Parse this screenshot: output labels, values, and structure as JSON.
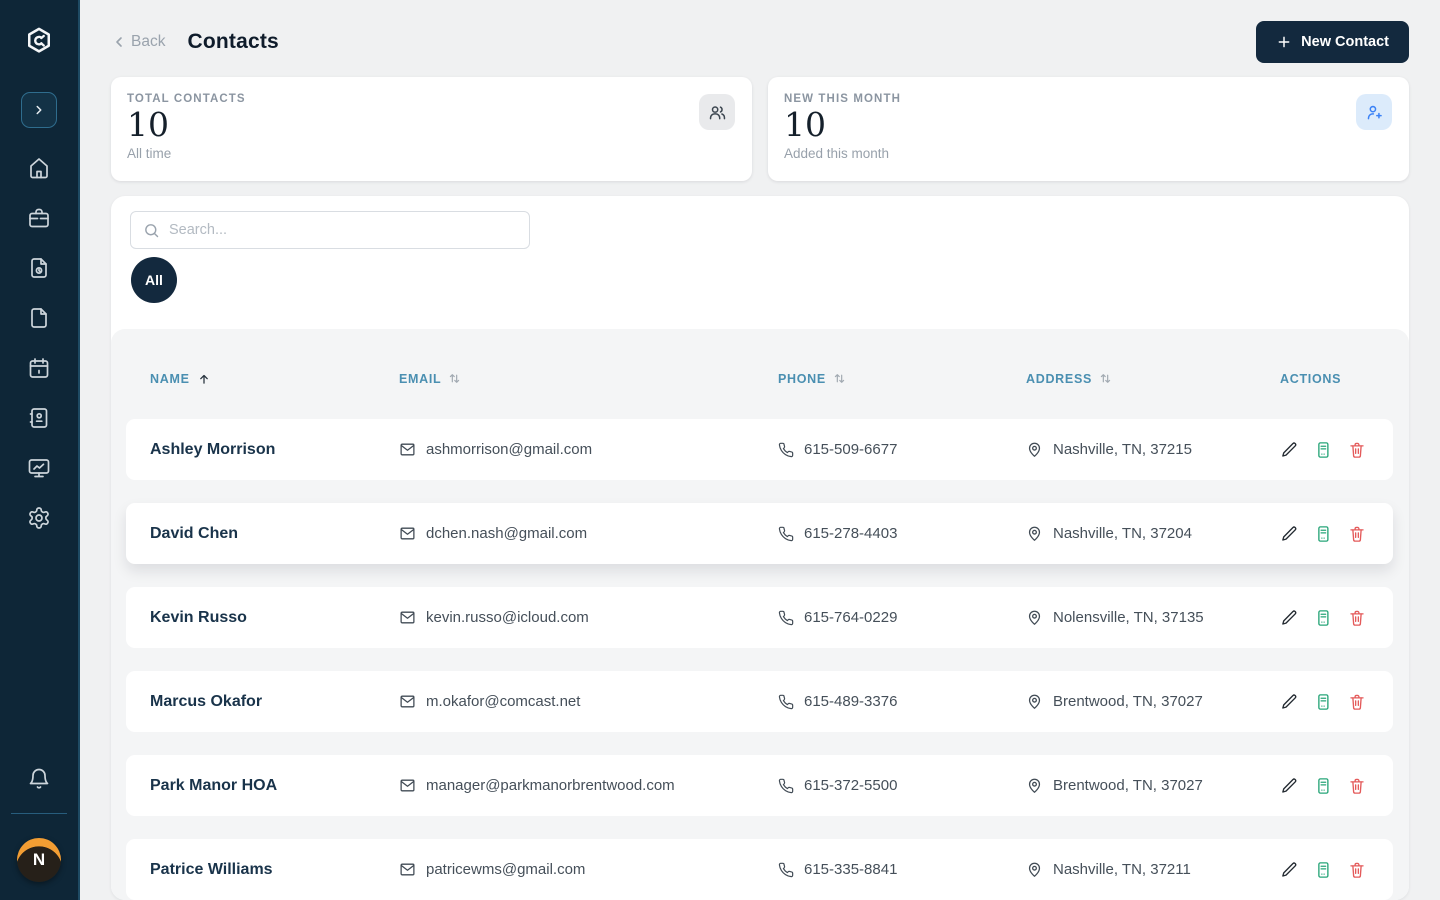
{
  "sidebar": {
    "icons": [
      "logo-hex-wrench-icon",
      "collapse-chevron-icon",
      "home-icon",
      "briefcase-icon",
      "file-badge-icon",
      "file-icon",
      "calendar-icon",
      "contact-book-icon",
      "monitor-chart-icon",
      "gear-icon",
      "bell-icon"
    ],
    "avatar_initial": "N"
  },
  "header": {
    "back_label": "Back",
    "title": "Contacts",
    "new_contact_label": "New Contact"
  },
  "stats": [
    {
      "label": "TOTAL CONTACTS",
      "value": "10",
      "sublabel": "All time",
      "icon": "users-icon"
    },
    {
      "label": "NEW THIS MONTH",
      "value": "10",
      "sublabel": "Added this month",
      "icon": "user-plus-icon"
    }
  ],
  "filters": {
    "search_placeholder": "Search...",
    "filter_all_label": "All"
  },
  "table": {
    "columns": [
      {
        "label": "NAME",
        "sort": "asc"
      },
      {
        "label": "EMAIL",
        "sort": "both"
      },
      {
        "label": "PHONE",
        "sort": "both"
      },
      {
        "label": "ADDRESS",
        "sort": "both"
      },
      {
        "label": "ACTIONS",
        "sort": "none"
      }
    ],
    "rows": [
      {
        "name": "Ashley Morrison",
        "email": "ashmorrison@gmail.com",
        "phone": "615-509-6677",
        "address": "Nashville, TN, 37215",
        "hovered": false
      },
      {
        "name": "David Chen",
        "email": "dchen.nash@gmail.com",
        "phone": "615-278-4403",
        "address": "Nashville, TN, 37204",
        "hovered": true
      },
      {
        "name": "Kevin Russo",
        "email": "kevin.russo@icloud.com",
        "phone": "615-764-0229",
        "address": "Nolensville, TN, 37135",
        "hovered": false
      },
      {
        "name": "Marcus Okafor",
        "email": "m.okafor@comcast.net",
        "phone": "615-489-3376",
        "address": "Brentwood, TN, 37027",
        "hovered": false
      },
      {
        "name": "Park Manor HOA",
        "email": "manager@parkmanorbrentwood.com",
        "phone": "615-372-5500",
        "address": "Brentwood, TN, 37027",
        "hovered": false
      },
      {
        "name": "Patrice Williams",
        "email": "patricewms@gmail.com",
        "phone": "615-335-8841",
        "address": "Nashville, TN, 37211",
        "hovered": false
      }
    ]
  },
  "colors": {
    "accent_navy": "#13293e",
    "sidebar_navy": "#0e2637",
    "header_blue": "#4a8fb1",
    "edit_dark": "#232a31",
    "export_green": "#27a578",
    "delete_red": "#e45a5a",
    "newmonth_blue": "#3b82f6",
    "avatar_orange": "#f29d33"
  }
}
